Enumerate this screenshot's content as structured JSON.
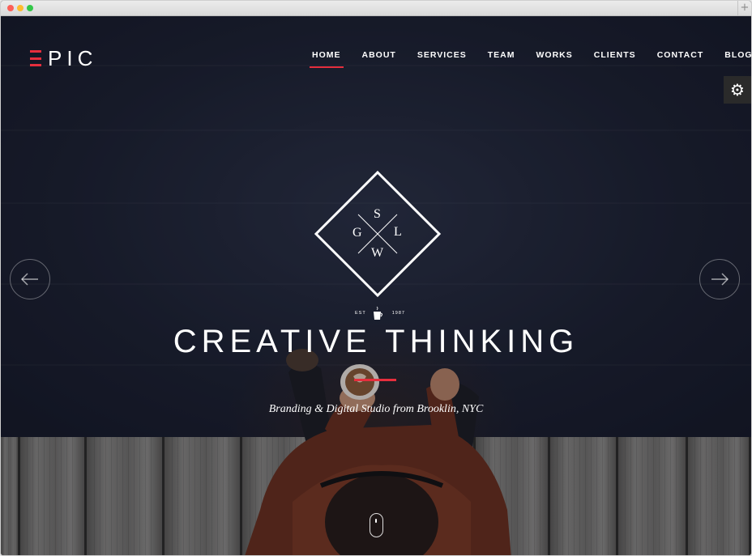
{
  "brand": {
    "logo_text": "PIC",
    "accent_color": "#e62e3d"
  },
  "nav": {
    "items": [
      {
        "label": "HOME",
        "active": true
      },
      {
        "label": "ABOUT",
        "active": false
      },
      {
        "label": "SERVICES",
        "active": false
      },
      {
        "label": "TEAM",
        "active": false
      },
      {
        "label": "WORKS",
        "active": false
      },
      {
        "label": "CLIENTS",
        "active": false
      },
      {
        "label": "CONTACT",
        "active": false
      },
      {
        "label": "BLOG",
        "active": false
      }
    ]
  },
  "settings": {
    "icon": "gear-icon"
  },
  "slider": {
    "prev_icon": "arrow-left-icon",
    "next_icon": "arrow-right-icon"
  },
  "emblem": {
    "letters": {
      "top": "S",
      "left": "G",
      "right": "L",
      "bottom": "W"
    },
    "est_label": "EST",
    "year": "1987",
    "cup_icon": "coffee-cup-icon"
  },
  "hero": {
    "headline": "CREATIVE THINKING",
    "tagline": "Branding & Digital Studio from Brooklin, NYC"
  },
  "scroll": {
    "icon": "mouse-scroll-icon"
  }
}
